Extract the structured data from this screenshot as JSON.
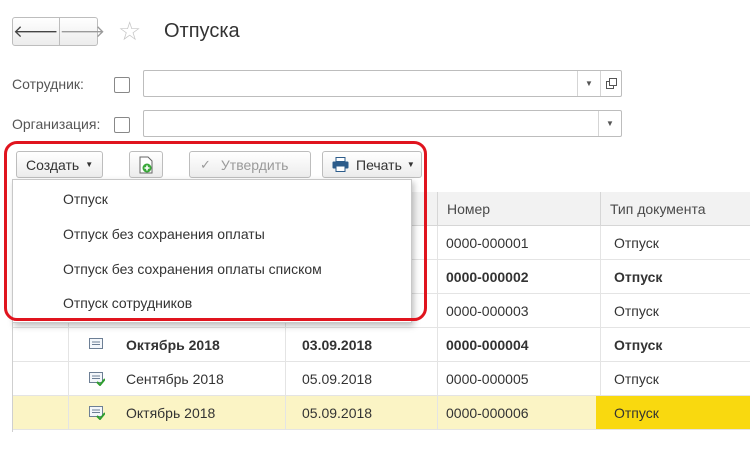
{
  "header": {
    "title": "Отпуска",
    "back_arrow": "🡐",
    "forward_arrow": "🡒"
  },
  "filters": {
    "employee_label": "Сотрудник:",
    "organization_label": "Организация:"
  },
  "toolbar": {
    "create_label": "Создать",
    "approve_label": "Утвердить",
    "print_label": "Печать"
  },
  "menu": {
    "items": [
      "Отпуск",
      "Отпуск без сохранения оплаты",
      "Отпуск без сохранения оплаты списком",
      "Отпуск сотрудников"
    ]
  },
  "table": {
    "columns": [
      "Номер",
      "Тип документа"
    ],
    "rows": [
      {
        "period": "",
        "date": "",
        "number": "0000-000001",
        "type": "Отпуск",
        "bold": false,
        "selected": false
      },
      {
        "period": "",
        "date": "",
        "number": "0000-000002",
        "type": "Отпуск",
        "bold": true,
        "selected": false
      },
      {
        "period": "",
        "date": "",
        "number": "0000-000003",
        "type": "Отпуск",
        "bold": false,
        "selected": false
      },
      {
        "period": "Октябрь 2018",
        "date": "03.09.2018",
        "number": "0000-000004",
        "type": "Отпуск",
        "bold": true,
        "selected": false,
        "icon": "document-icon"
      },
      {
        "period": "Сентябрь 2018",
        "date": "05.09.2018",
        "number": "0000-000005",
        "type": "Отпуск",
        "bold": false,
        "selected": false,
        "icon": "document-posted-icon"
      },
      {
        "period": "Октябрь 2018",
        "date": "05.09.2018",
        "number": "0000-000006",
        "type": "Отпуск",
        "bold": false,
        "selected": true,
        "icon": "document-posted-icon"
      }
    ]
  },
  "colors": {
    "highlight": "#e0141e",
    "selected_row": "#fbf4c5",
    "selected_cell": "#f9d90f"
  }
}
